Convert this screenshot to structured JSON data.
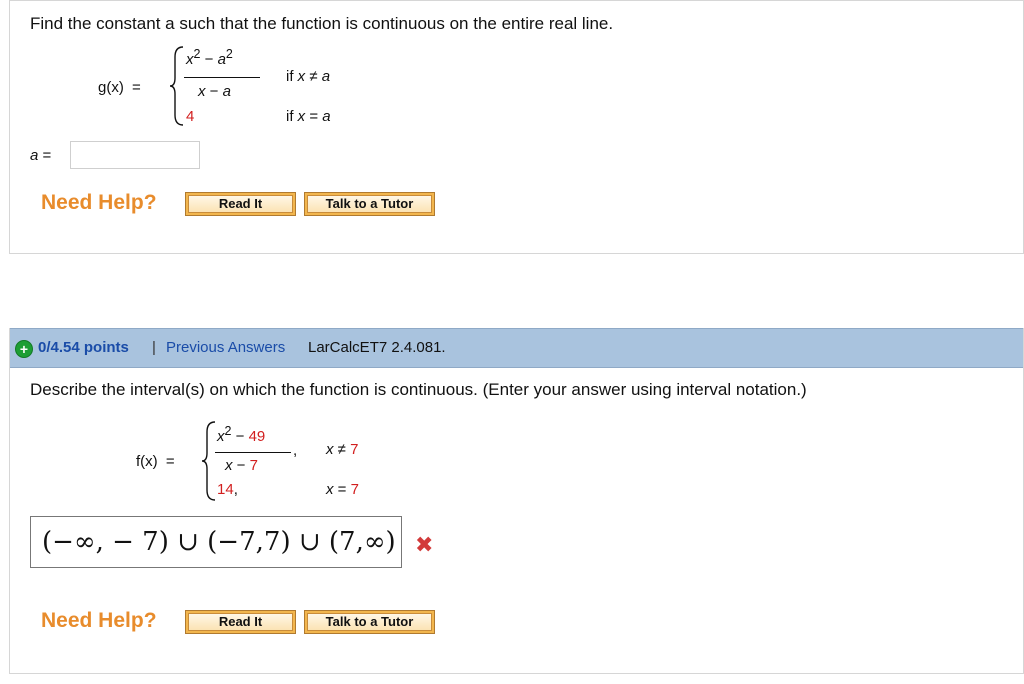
{
  "q1": {
    "prompt": "Find the constant a such that the function is continuous on the entire real line.",
    "func_name": "g(x)",
    "equals": "=",
    "num_x2": "x",
    "num_sup1": "2",
    "num_minus": " − ",
    "num_a": "a",
    "num_sup2": "2",
    "den_x": "x",
    "den_minus": " − ",
    "den_a": "a",
    "case1_cond_if": "if ",
    "case1_cond_x": "x",
    "case1_cond_ne": " ≠ ",
    "case1_cond_a": "a",
    "case2_value": "4",
    "case2_cond_if": "if ",
    "case2_cond_x": "x",
    "case2_cond_eq": " = ",
    "case2_cond_a": "a",
    "answer_label_var": "a",
    "answer_label_eq": " =",
    "answer_value": "",
    "need_help": "Need Help?",
    "read_it": "Read It",
    "talk_tutor": "Talk to a Tutor"
  },
  "q2": {
    "points": "0/4.54 points",
    "separator": "|",
    "previous_answers": "Previous Answers",
    "reference": "LarCalcET7 2.4.081.",
    "prompt": "Describe the interval(s) on which the function is continuous. (Enter your answer using interval notation.)",
    "func_name": "f(x)",
    "equals": "=",
    "num_x": "x",
    "num_sup": "2",
    "num_minus": " − ",
    "num_const": "49",
    "den_x": "x",
    "den_minus": " − ",
    "den_const": "7",
    "case1_comma": ",",
    "case1_cond_x": "x",
    "case1_cond_ne": " ≠ ",
    "case1_cond_val": "7",
    "case2_value": "14",
    "case2_comma": ",",
    "case2_cond_x": "x",
    "case2_cond_eq": " = ",
    "case2_cond_val": "7",
    "answer": "(−∞, − 7) ∪ (−7,7) ∪ (7,∞)",
    "result_icon": "cross-icon",
    "need_help": "Need Help?",
    "read_it": "Read It",
    "talk_tutor": "Talk to a Tutor"
  },
  "colors": {
    "accent_red": "#d21f1f",
    "help_orange": "#e88c2c",
    "header_blue": "#a9c3de",
    "link_blue": "#1a4ca8"
  }
}
